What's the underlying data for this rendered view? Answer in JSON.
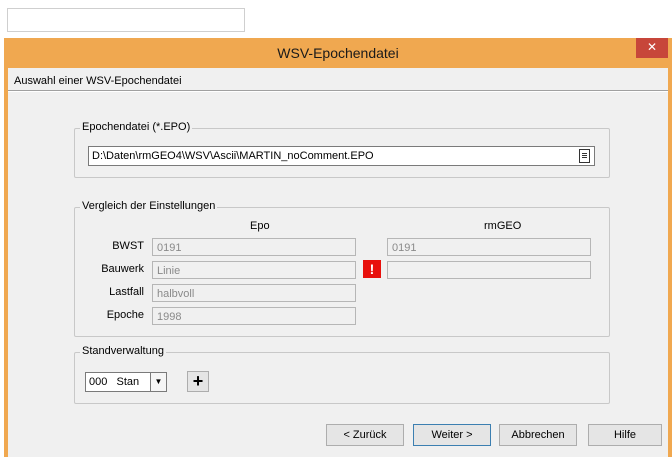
{
  "window": {
    "title": "WSV-Epochendatei",
    "close_glyph": "✕",
    "header": "Auswahl einer WSV-Epochendatei"
  },
  "epochendatei": {
    "group_label": "Epochendatei (*.EPO)",
    "path": "D:\\Daten\\rmGEO4\\WSV\\Ascii\\MARTIN_noComment.EPO",
    "browse_icon": "file-icon"
  },
  "vergleich": {
    "group_label": "Vergleich der Einstellungen",
    "col_epo": "Epo",
    "col_rmgeo": "rmGEO",
    "rows": [
      {
        "label": "BWST",
        "epo": "0191",
        "rmgeo": "0191"
      },
      {
        "label": "Bauwerk",
        "epo": "Linie",
        "rmgeo": "",
        "warning": "!"
      },
      {
        "label": "Lastfall",
        "epo": "halbvoll"
      },
      {
        "label": "Epoche",
        "epo": "1998"
      }
    ]
  },
  "standverwaltung": {
    "group_label": "Standverwaltung",
    "select_value": "000   Stan",
    "add_symbol": "+"
  },
  "buttons": {
    "back": "< Zurück",
    "next": "Weiter >",
    "cancel": "Abbrechen",
    "help": "Hilfe"
  },
  "colors": {
    "titlebar": "#f0a850",
    "close": "#c7463a",
    "warning": "#e8100c"
  }
}
